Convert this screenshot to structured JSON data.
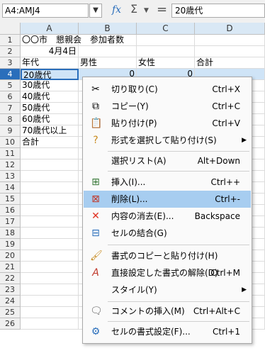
{
  "formula_bar": {
    "name_box": "A4:AMJ4",
    "function_icon": "fx-icon",
    "sum_icon": "sigma-icon",
    "equals_icon": "equals-icon",
    "content": "20歳代"
  },
  "columns": [
    "A",
    "B",
    "C",
    "D"
  ],
  "rows": [
    {
      "num": "1",
      "cells": [
        "〇〇市　懇親会　参加者数",
        "",
        "",
        ""
      ]
    },
    {
      "num": "2",
      "cells": [
        "4月4日",
        "",
        "",
        ""
      ]
    },
    {
      "num": "3",
      "cells": [
        "年代",
        "男性",
        "女性",
        "合計"
      ]
    },
    {
      "num": "4",
      "cells": [
        "20歳代",
        "0",
        "0",
        ""
      ]
    },
    {
      "num": "5",
      "cells": [
        "30歳代",
        "",
        "",
        ""
      ]
    },
    {
      "num": "6",
      "cells": [
        "40歳代",
        "",
        "",
        ""
      ]
    },
    {
      "num": "7",
      "cells": [
        "50歳代",
        "",
        "",
        ""
      ]
    },
    {
      "num": "8",
      "cells": [
        "60歳代",
        "",
        "",
        ""
      ]
    },
    {
      "num": "9",
      "cells": [
        "70歳代以上",
        "",
        "",
        ""
      ]
    },
    {
      "num": "10",
      "cells": [
        "合計",
        "",
        "",
        ""
      ]
    },
    {
      "num": "11",
      "cells": [
        "",
        "",
        "",
        ""
      ]
    },
    {
      "num": "12",
      "cells": [
        "",
        "",
        "",
        ""
      ]
    },
    {
      "num": "13",
      "cells": [
        "",
        "",
        "",
        ""
      ]
    },
    {
      "num": "14",
      "cells": [
        "",
        "",
        "",
        ""
      ]
    },
    {
      "num": "15",
      "cells": [
        "",
        "",
        "",
        ""
      ]
    },
    {
      "num": "16",
      "cells": [
        "",
        "",
        "",
        ""
      ]
    },
    {
      "num": "17",
      "cells": [
        "",
        "",
        "",
        ""
      ]
    },
    {
      "num": "18",
      "cells": [
        "",
        "",
        "",
        ""
      ]
    },
    {
      "num": "19",
      "cells": [
        "",
        "",
        "",
        ""
      ]
    },
    {
      "num": "20",
      "cells": [
        "",
        "",
        "",
        ""
      ]
    },
    {
      "num": "21",
      "cells": [
        "",
        "",
        "",
        ""
      ]
    },
    {
      "num": "22",
      "cells": [
        "",
        "",
        "",
        ""
      ]
    },
    {
      "num": "23",
      "cells": [
        "",
        "",
        "",
        ""
      ]
    },
    {
      "num": "24",
      "cells": [
        "",
        "",
        "",
        ""
      ]
    },
    {
      "num": "25",
      "cells": [
        "",
        "",
        "",
        ""
      ]
    },
    {
      "num": "26",
      "cells": [
        "",
        "",
        "",
        ""
      ]
    }
  ],
  "context_menu": {
    "items": [
      {
        "label": "切り取り(C)",
        "shortcut": "Ctrl+X",
        "icon": "scissors-icon"
      },
      {
        "label": "コピー(Y)",
        "shortcut": "Ctrl+C",
        "icon": "copy-icon"
      },
      {
        "label": "貼り付け(P)",
        "shortcut": "Ctrl+V",
        "icon": "paste-icon"
      },
      {
        "label": "形式を選択して貼り付け(S)",
        "shortcut": "",
        "icon": "paste-special-icon"
      },
      {
        "label": "選択リスト(A)",
        "shortcut": "Alt+Down",
        "icon": ""
      },
      {
        "label": "挿入(I)...",
        "shortcut": "Ctrl++",
        "icon": "insert-cells-icon"
      },
      {
        "label": "削除(L)...",
        "shortcut": "Ctrl+-",
        "icon": "delete-cells-icon"
      },
      {
        "label": "内容の消去(E)...",
        "shortcut": "Backspace",
        "icon": "clear-contents-icon"
      },
      {
        "label": "セルの結合(G)",
        "shortcut": "",
        "icon": "merge-cells-icon"
      },
      {
        "label": "書式のコピーと貼り付け(H)",
        "shortcut": "",
        "icon": "clone-formatting-icon"
      },
      {
        "label": "直接設定した書式の解除(D)",
        "shortcut": "Ctrl+M",
        "icon": "clear-formatting-icon"
      },
      {
        "label": "スタイル(Y)",
        "shortcut": "",
        "icon": ""
      },
      {
        "label": "コメントの挿入(M)",
        "shortcut": "Ctrl+Alt+C",
        "icon": "comment-icon"
      },
      {
        "label": "セルの書式設定(F)...",
        "shortcut": "Ctrl+1",
        "icon": "format-cells-icon"
      }
    ]
  }
}
